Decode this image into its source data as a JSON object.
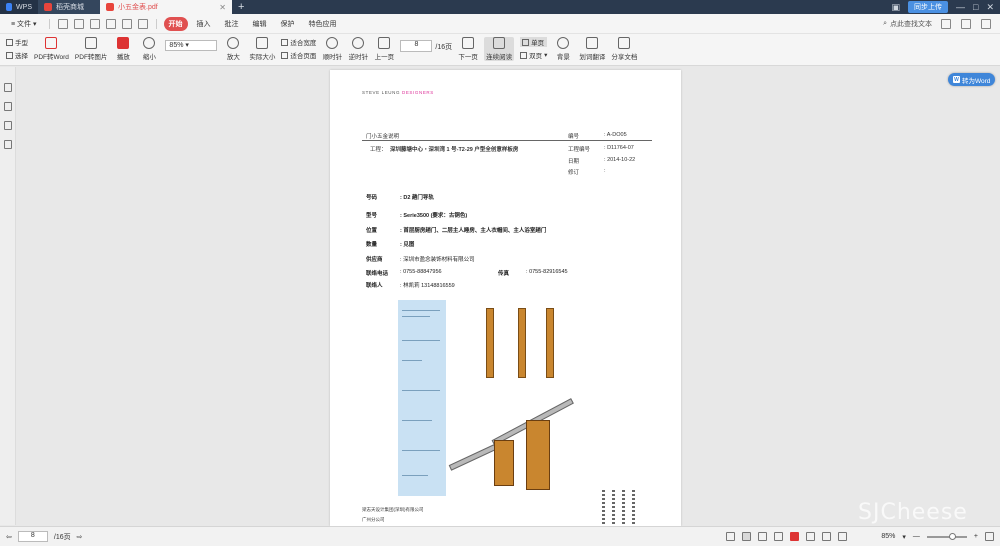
{
  "titlebar": {
    "tabs": [
      {
        "label": "WPS"
      },
      {
        "label": "稻壳商城"
      },
      {
        "label": "小五金表.pdf"
      }
    ],
    "upload_label": "同步上传"
  },
  "menubar": {
    "file_label": "文件",
    "items": [
      "开始",
      "插入",
      "批注",
      "编辑",
      "保护",
      "特色应用"
    ],
    "find_label": "点此查找文本"
  },
  "ribbon": {
    "hand": "手型",
    "select": "选择",
    "pdf_to_word": "PDF转Word",
    "pdf_to_image": "PDF转图片",
    "play": "播放",
    "zoom_out": "缩小",
    "zoom_value": "85%",
    "zoom_in": "放大",
    "actual_size": "实际大小",
    "fit_width": "适合宽度",
    "fit_page": "适合页面",
    "rotate_ccw": "顺时针",
    "rotate_cw": "逆时针",
    "prev_page": "上一页",
    "page_current": "8",
    "page_total": "/16页",
    "next_page": "下一页",
    "continuous": "连续阅读",
    "single": "单页",
    "double": "双页",
    "background": "背景",
    "translate": "划词翻译",
    "share": "分享文档"
  },
  "document": {
    "brand": "STEVE LEUNG",
    "brand_accent": "DESIGNERS",
    "header_left": "门小五金说明",
    "project_label": "工程：",
    "project_name": "深圳藤塘中心・深圳湾 1 号-T2-29 户型全创意样板房",
    "meta": [
      {
        "label": "编号",
        "value": "A-DO05"
      },
      {
        "label": "工程编号",
        "value": "D11764-07"
      },
      {
        "label": "日期",
        "value": "2014-10-22"
      },
      {
        "label": "修订",
        "value": ""
      }
    ],
    "fields": [
      {
        "label": "号码",
        "value": "D2  趟门导轨"
      },
      {
        "label": "型号",
        "value": "Serie3500 (要求：古铜色)"
      },
      {
        "label": "位置",
        "value": "首层厨房趟门、二层主人睡房、主人衣帽间、主人浴室趟门"
      },
      {
        "label": "数量",
        "value": "见图"
      },
      {
        "label": "供应商",
        "value": "深圳市盈念装饰材料有限公司"
      },
      {
        "label": "联络电话",
        "value": "0755-88847956"
      },
      {
        "label": "传真",
        "value": "0755-82916545"
      },
      {
        "label": "联络人",
        "value": "林凯莉    13148816559"
      }
    ],
    "footer_line1": "梁志天设计集团(深圳)有限公司",
    "footer_line2": "广州分公司"
  },
  "float_button": {
    "label": "转为Word"
  },
  "watermark": "SJCheese",
  "statusbar": {
    "page_current": "8",
    "page_total": "/16页",
    "zoom": "85%"
  }
}
